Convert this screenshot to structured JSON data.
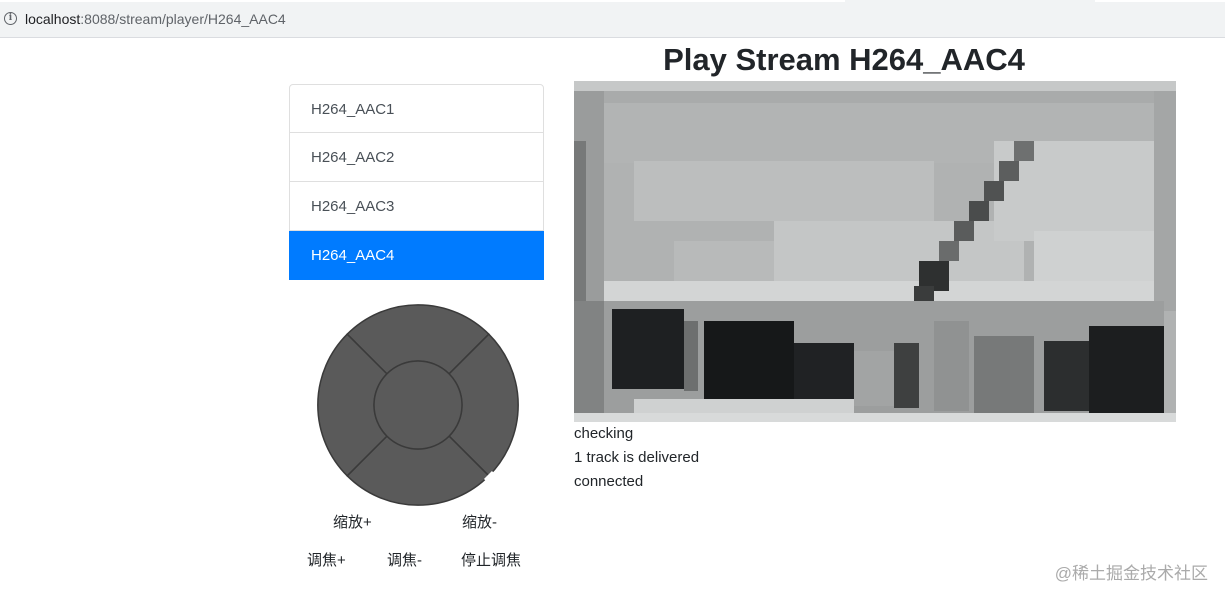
{
  "browser": {
    "url_host": "localhost",
    "url_path": ":8088/stream/player/H264_AAC4"
  },
  "page": {
    "title": "Play Stream H264_AAC4"
  },
  "streams": {
    "items": [
      {
        "label": "H264_AAC1",
        "active": false
      },
      {
        "label": "H264_AAC2",
        "active": false
      },
      {
        "label": "H264_AAC3",
        "active": false
      },
      {
        "label": "H264_AAC4",
        "active": true
      }
    ],
    "active_color": "#007bff"
  },
  "ptz": {
    "wheel_color": "#5a5a5a",
    "zoom_in": "缩放+",
    "zoom_out": "缩放-",
    "focus_in": "调焦+",
    "focus_out": "调焦-",
    "stop_focus": "停止调焦"
  },
  "status": {
    "line1": "checking",
    "line2": "1 track is delivered",
    "line3": "connected"
  },
  "watermark": "@稀土掘金技术社区"
}
